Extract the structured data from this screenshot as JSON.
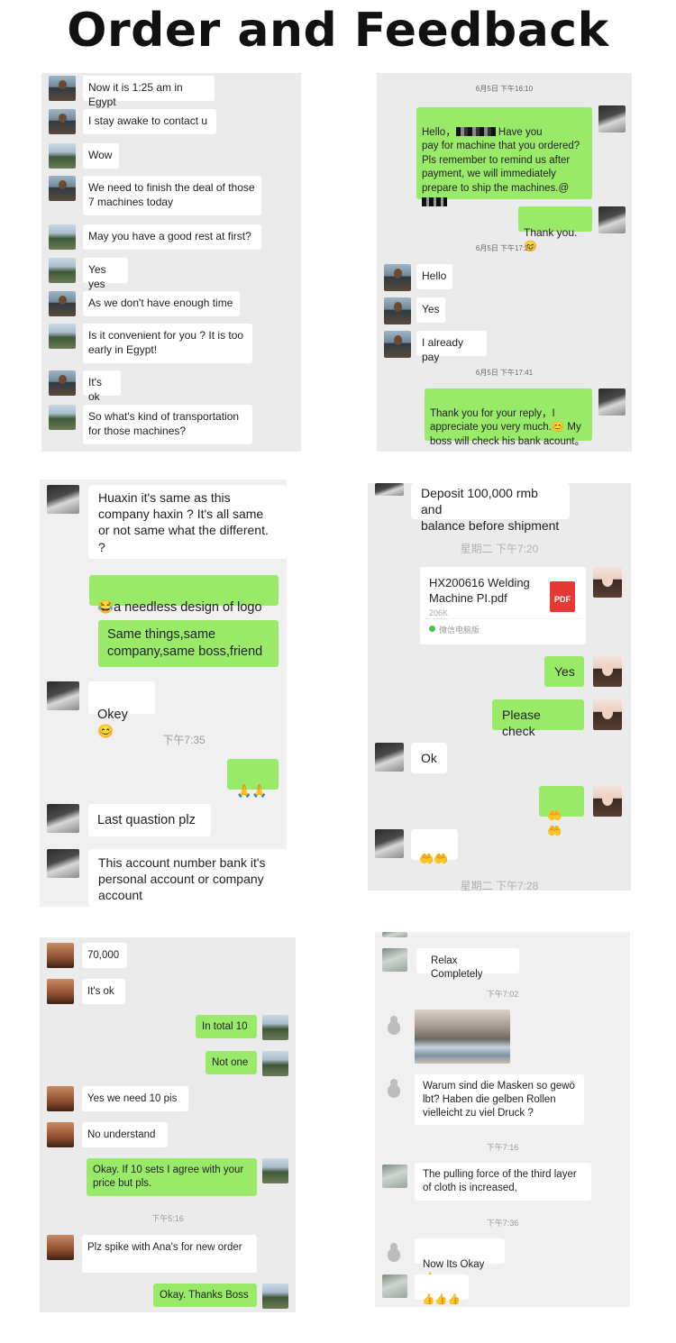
{
  "title": "Order and Feedback",
  "p1": {
    "messages": [
      "Now it is 1:25 am in Egypt",
      "I stay awake to contact u",
      "Wow",
      "We need to finish the deal of those\n7 machines today",
      "May you have a good rest at first?",
      "Yes yes",
      "As we don't have enough time",
      "Is it convenient for you ? It is too\nearly in Egypt!",
      "It's ok",
      "So what's kind of transportation\nfor those machines?"
    ]
  },
  "p2": {
    "ts1": "6月5日 下午16:10",
    "m1a": "Hello，",
    "m1b": "Have you\npay for machine that you ordered?\nPls remember to remind us after\npayment, we will immediately\nprepare to ship the machines.@",
    "m2": "Thank you.",
    "ts2": "6月5日 下午17:29",
    "m3": "Hello",
    "m4": "Yes",
    "m5": "I already pay",
    "ts3": "6月5日 下午17:41",
    "m6": "Thank you for your reply，I\nappreciate you very much.",
    "m6b": "My\nboss will check his bank acount。"
  },
  "p3": {
    "m1": "Huaxin it's same as this\ncompany haxin ? It's all same\nor not same what the different.\n ?",
    "m2": "a needless design of logo",
    "m3": "Same things,same\ncompany,same boss,friend",
    "m4": "Okey",
    "ts": "下午7:35",
    "m6": "Last quastion plz",
    "m7": "This account number bank it's\npersonal account  or company\naccount"
  },
  "p4": {
    "m1": "Deposit 100,000 rmb and\nbalance  before shipment",
    "ts1": "星期二 下午7:20",
    "file_name": "HX200616 Welding\nMachine PI.pdf",
    "file_size": "206K",
    "file_source": "微信电脑版",
    "file_badge": "PDF",
    "m3": "Yes",
    "m4": "Please check",
    "m5": "Ok",
    "ts2": "星期二 下午7:28"
  },
  "p5": {
    "m1": "70,000",
    "m2": "It's ok",
    "m3": "In total 10",
    "m4": "Not one",
    "m5": "Yes we need 10 pis",
    "m6": "No understand",
    "m7": "Okay. If 10 sets I agree with your\nprice but pls.",
    "ts": "下午5:16",
    "m8": "Plz spike with Ana's for new order",
    "m9": "Okay. Thanks Boss"
  },
  "p6": {
    "m1": "Relax Completely",
    "ts1": "下午7:02",
    "m3": "Warum sind die Masken so gewö\nlbt? Haben die gelben Rollen\nvielleicht zu viel Druck ?",
    "ts2": "下午7:16",
    "m4": "The pulling force of the third layer\nof cloth is increased,",
    "ts3": "下午7:36",
    "m5": "Now Its Okay"
  }
}
